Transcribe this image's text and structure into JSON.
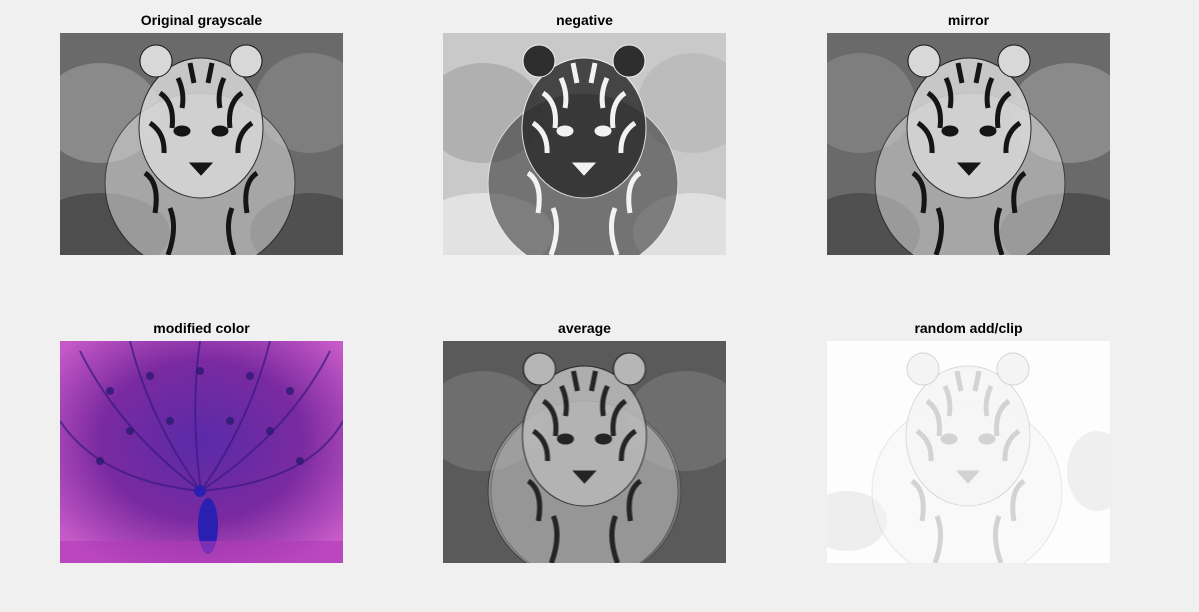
{
  "window": {
    "background": "#f0f0f0"
  },
  "panels": [
    {
      "title": "Original grayscale",
      "image": "tiger-grayscale"
    },
    {
      "title": "negative",
      "image": "tiger-negative"
    },
    {
      "title": "mirror",
      "image": "tiger-mirror"
    },
    {
      "title": "modified color",
      "image": "peacock-purple"
    },
    {
      "title": "average",
      "image": "tiger-average"
    },
    {
      "title": "random add/clip",
      "image": "tiger-washed-out"
    }
  ],
  "colors": {
    "title_text": "#000000",
    "peacock_magenta": "#b03ab8",
    "peacock_blue": "#2a1fb0"
  }
}
